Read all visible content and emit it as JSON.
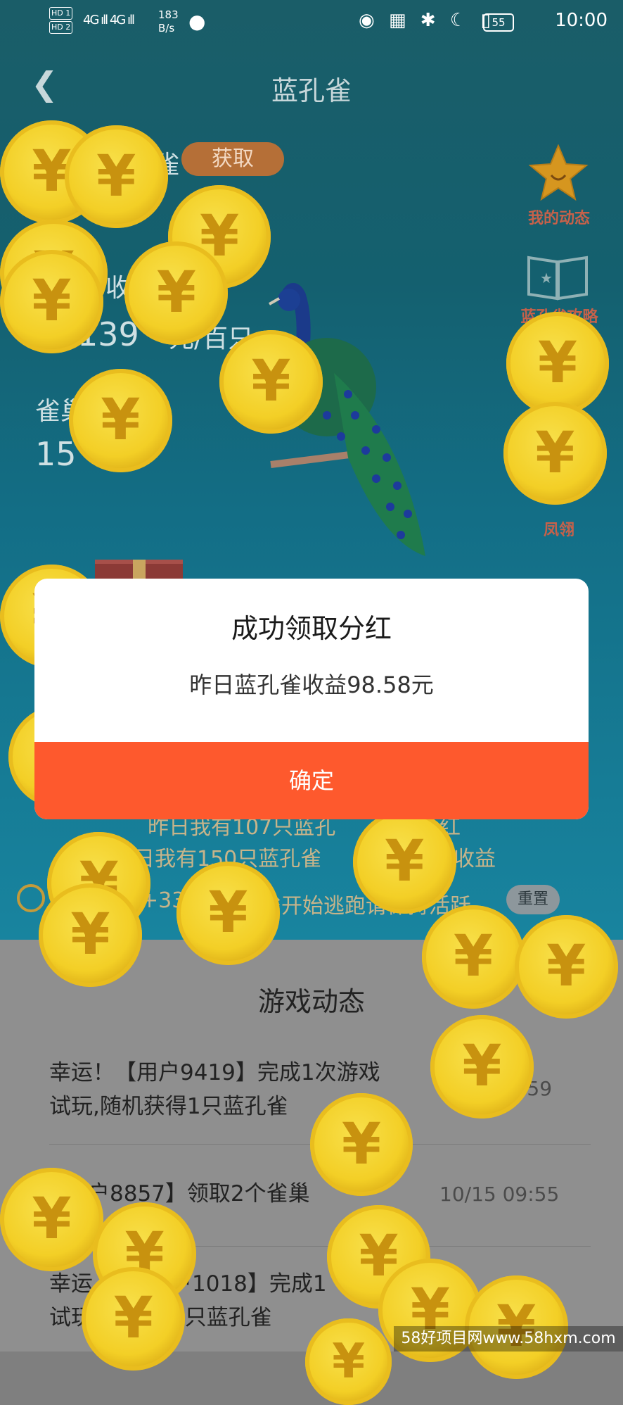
{
  "status_bar": {
    "hd1": "HD 1",
    "hd2": "HD 2",
    "signal": "4G ıll 4G ıll",
    "speed_value": "183",
    "speed_unit": "B/s",
    "battery": "55",
    "time": "10:00",
    "icons": [
      "eye-icon",
      "nfc-icon",
      "bluetooth-icon",
      "moon-icon",
      "vibrate-icon"
    ]
  },
  "header": {
    "back_icon": "chevron-left-icon",
    "title": "蓝孔雀"
  },
  "info": {
    "label1": "我",
    "label1_tail": "雀",
    "get_button": "获取",
    "value1": "15",
    "label2_tail": "收益",
    "value2": "139",
    "value2_unit": "元/百只",
    "label3": "雀巢",
    "value3": "15"
  },
  "side_menu": [
    {
      "label": "我的动态",
      "icon": "star-icon"
    },
    {
      "label": "蓝孔雀攻略",
      "icon": "book-icon"
    },
    {
      "label": "凤翎",
      "icon": "feather-icon"
    }
  ],
  "under_modal": {
    "line1": "昨日我有107只蓝孔",
    "line1_tail": "分红",
    "line2": "明日我有150只蓝孔雀",
    "line2_tail": "主收益",
    "warning_prefix": "+33",
    "warning": "雀开始逃跑请保持活跃",
    "reset_button": "重置"
  },
  "modal": {
    "title": "成功领取分红",
    "message": "昨日蓝孔雀收益98.58元",
    "confirm": "确定"
  },
  "feed": {
    "title": "游戏动态",
    "items": [
      {
        "line1": "幸运！【用户9419】完成1次游戏",
        "line2": "试玩,随机获得1只蓝孔雀",
        "time": ":59"
      },
      {
        "line1": "户8857】领取2个雀巢",
        "line2": "",
        "time": "10/15 09:55"
      },
      {
        "line1": "幸运",
        "line1b": "户1018】完成1",
        "line2": "试玩",
        "line2b": "得1只蓝孔雀",
        "time": ""
      }
    ]
  },
  "coin_symbol": "¥",
  "watermark": "58好项目网www.58hxm.com",
  "colors": {
    "accent": "#fe592d",
    "coin": "#f3cf26",
    "header_bg": "#1a5d68"
  }
}
